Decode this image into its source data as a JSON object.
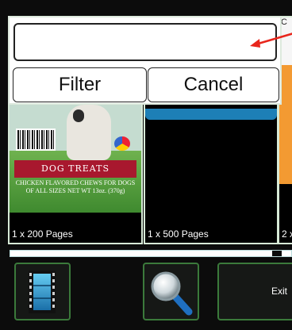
{
  "dialog": {
    "input_value": "",
    "filter_label": "Filter",
    "cancel_label": "Cancel"
  },
  "cards": [
    {
      "caption": "1 x 200 Pages",
      "ribbon": "DOG TREATS",
      "subtitle": "CHICKEN FLAVORED CHEWS FOR DOGS OF ALL SIZES NET WT 13oz. (370g)"
    },
    {
      "caption": "1 x 500 Pages"
    },
    {
      "caption": "2 x",
      "top_letter": "C"
    }
  ],
  "progress": {
    "fraction": 0.9
  },
  "toolbar": {
    "exit_label": "Exit"
  },
  "colors": {
    "toolbar_border": "#3b7a3b",
    "annotation_arrow": "#e8261c",
    "ribbon": "#a8182e",
    "blue_strip": "#1d7fb6"
  }
}
